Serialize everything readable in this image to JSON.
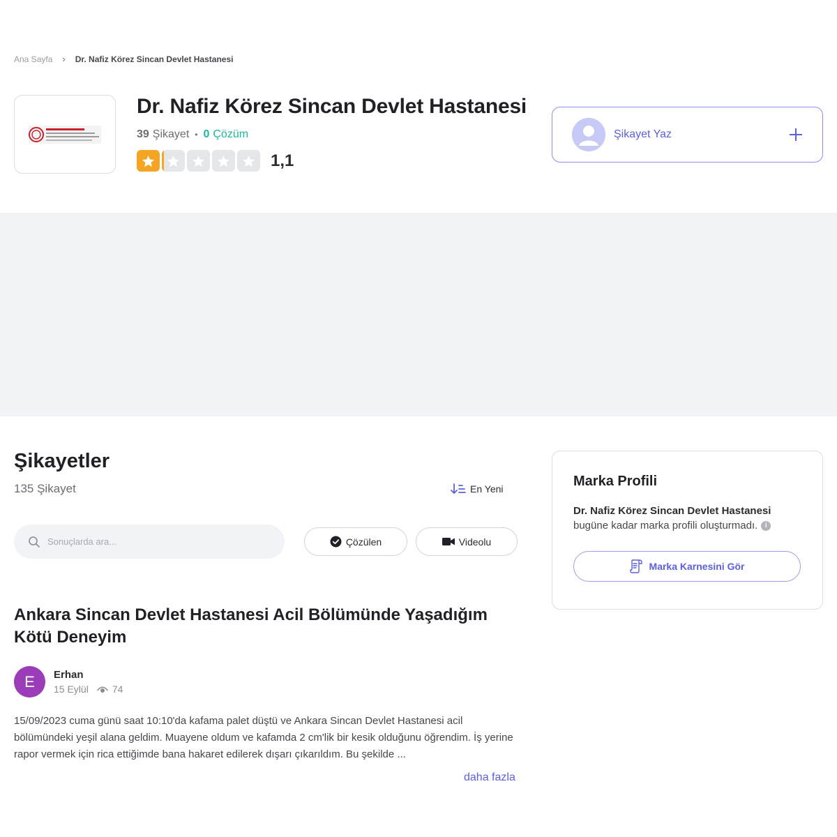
{
  "breadcrumb": {
    "home": "Ana Sayfa",
    "current": "Dr. Nafiz Körez Sincan Devlet Hastanesi"
  },
  "brand": {
    "name": "Dr. Nafiz Körez Sincan Devlet Hastanesi",
    "complaint_count": "39",
    "complaint_label": "Şikayet",
    "solved_count": "0",
    "solved_label": "Çözüm",
    "rating": "1,1",
    "rating_value": 1.1,
    "rating_max": 5,
    "logo_icon": "ministry-of-health-logo"
  },
  "write_complaint": {
    "label": "Şikayet Yaz"
  },
  "complaints_section": {
    "title": "Şikayetler",
    "count_text": "135 Şikayet",
    "sort_label": "En Yeni",
    "search_placeholder": "Sonuçlarda ara...",
    "filters": {
      "solved": "Çözülen",
      "video": "Videolu"
    }
  },
  "brand_profile": {
    "title": "Marka Profili",
    "brand_name": "Dr. Nafiz Körez Sincan Devlet Hastanesi",
    "description": "bugüne kadar marka profili oluşturmadı.",
    "info_icon": "i",
    "scorecard_button": "Marka Karnesini Gör"
  },
  "complaint": {
    "title": "Ankara Sincan Devlet Hastanesi Acil Bölümünde Yaşadığım Kötü Deneyim",
    "author_initial": "E",
    "author_name": "Erhan",
    "date": "15 Eylül",
    "views": "74",
    "body": "15/09/2023 cuma günü saat 10:10'da kafama palet düştü ve Ankara Sincan Devlet Hastanesi acil bölümündeki yeşil alana geldim. Muayene oldum ve kafamda 2 cm'lik bir kesik olduğunu öğrendim. İş yerine rapor vermek için rica ettiğimde bana hakaret edilerek dışarı çıkarıldım. Bu şekilde ...",
    "more_link": "daha fazla"
  },
  "colors": {
    "accent": "#5b5fdd",
    "star": "#f5a524",
    "solved": "#1cb6a0",
    "avatar": "#9b3db8"
  }
}
